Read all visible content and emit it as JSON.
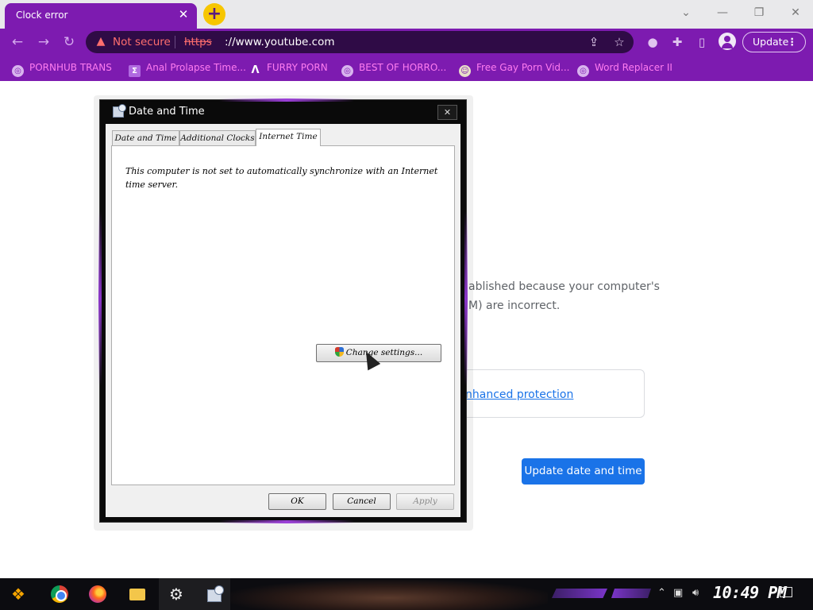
{
  "browser": {
    "tab": {
      "title": "Clock error",
      "close_glyph": "✕"
    },
    "new_tab_glyph": "+",
    "window_controls": {
      "minimize": "—",
      "restore": "❐",
      "close": "✕",
      "tabsearch": "⌄"
    },
    "address": {
      "security_label": "Not secure",
      "scheme": "https",
      "host": "://www.youtube.com"
    },
    "update_label": "Update",
    "bookmarks": [
      {
        "label": "PORNHUB TRANS",
        "icon": "globe-icon"
      },
      {
        "label": "Anal Prolapse Time...",
        "icon": "bookmark-icon"
      },
      {
        "label": "FURRY PORN",
        "icon": "letter-a-icon"
      },
      {
        "label": "BEST OF HORRO...",
        "icon": "globe-icon"
      },
      {
        "label": "Free Gay Porn Vid...",
        "icon": "site-icon"
      },
      {
        "label": "Word Replacer II",
        "icon": "globe-icon"
      }
    ]
  },
  "page": {
    "line1": "ablished because your computer's",
    "line2": "M) are incorrect.",
    "protection_link": "nhanced protection",
    "update_button": "Update date and time"
  },
  "dialog": {
    "title": "Date and Time",
    "close_glyph": "✕",
    "tabs": [
      "Date and Time",
      "Additional Clocks",
      "Internet Time"
    ],
    "active_tab": "Internet Time",
    "message": "This computer is not set to automatically synchronize with an Internet time server.",
    "change_button": "Change settings...",
    "ok": "OK",
    "cancel": "Cancel",
    "apply": "Apply"
  },
  "taskbar": {
    "clock": "10:49 PM"
  },
  "colors": {
    "chrome_purple": "#7d1bb0",
    "bookmark_text": "#ff7cf0",
    "warning_red": "#ff6e6e",
    "link_blue": "#1a73e8"
  }
}
